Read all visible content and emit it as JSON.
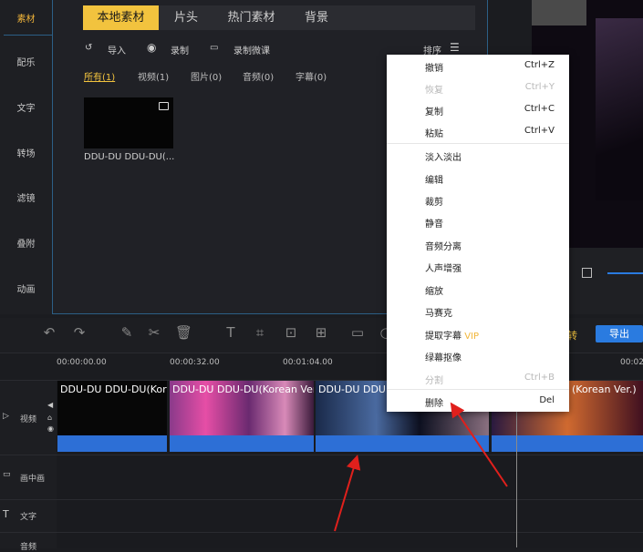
{
  "sidebar": {
    "items": [
      {
        "label": "素材",
        "active": true
      },
      {
        "label": "配乐"
      },
      {
        "label": "文字"
      },
      {
        "label": "转场"
      },
      {
        "label": "滤镜"
      },
      {
        "label": "叠附"
      },
      {
        "label": "动画"
      }
    ]
  },
  "tabs": [
    {
      "label": "本地素材",
      "active": true
    },
    {
      "label": "片头"
    },
    {
      "label": "热门素材"
    },
    {
      "label": "背景"
    }
  ],
  "tools": {
    "import": "导入",
    "record": "录制",
    "record_lesson": "录制微课",
    "sort": "排序"
  },
  "filters": [
    "所有(1)",
    "视频(1)",
    "图片(0)",
    "音频(0)",
    "字幕(0)"
  ],
  "media": {
    "name": "DDU-DU DDU-DU(..."
  },
  "toolbar": {
    "export": "导出",
    "partial": "转"
  },
  "timeline": {
    "ticks": [
      "00:00:00.00",
      "00:00:32.00",
      "00:01:04.00",
      "00:02"
    ],
    "tracks": {
      "video": "视频",
      "pip": "画中画",
      "text": "文字",
      "audio": "音频"
    },
    "clips": [
      "DDU-DU DDU-DU(Kor",
      "DDU-DU DDU-DU(Korean Ver.",
      "DDU-DU DDU",
      "(Korean Ver.)"
    ]
  },
  "context_menu": [
    {
      "label": "撤销",
      "shortcut": "Ctrl+Z"
    },
    {
      "label": "恢复",
      "shortcut": "Ctrl+Y",
      "disabled": true
    },
    {
      "label": "复制",
      "shortcut": "Ctrl+C"
    },
    {
      "label": "粘贴",
      "shortcut": "Ctrl+V"
    },
    {
      "label": "淡入淡出"
    },
    {
      "label": "编辑"
    },
    {
      "label": "裁剪"
    },
    {
      "label": "静音"
    },
    {
      "label": "音频分离"
    },
    {
      "label": "人声增强"
    },
    {
      "label": "缩放"
    },
    {
      "label": "马赛克"
    },
    {
      "label": "提取字幕",
      "badge": "VIP"
    },
    {
      "label": "绿幕抠像"
    },
    {
      "label": "分割",
      "shortcut": "Ctrl+B",
      "disabled": true
    },
    {
      "label": "删除",
      "shortcut": "Del"
    }
  ],
  "colors": {
    "accent": "#f2c33e",
    "export": "#2a7be0",
    "arrow": "#e0201c",
    "wave": "#2d6fd6"
  }
}
